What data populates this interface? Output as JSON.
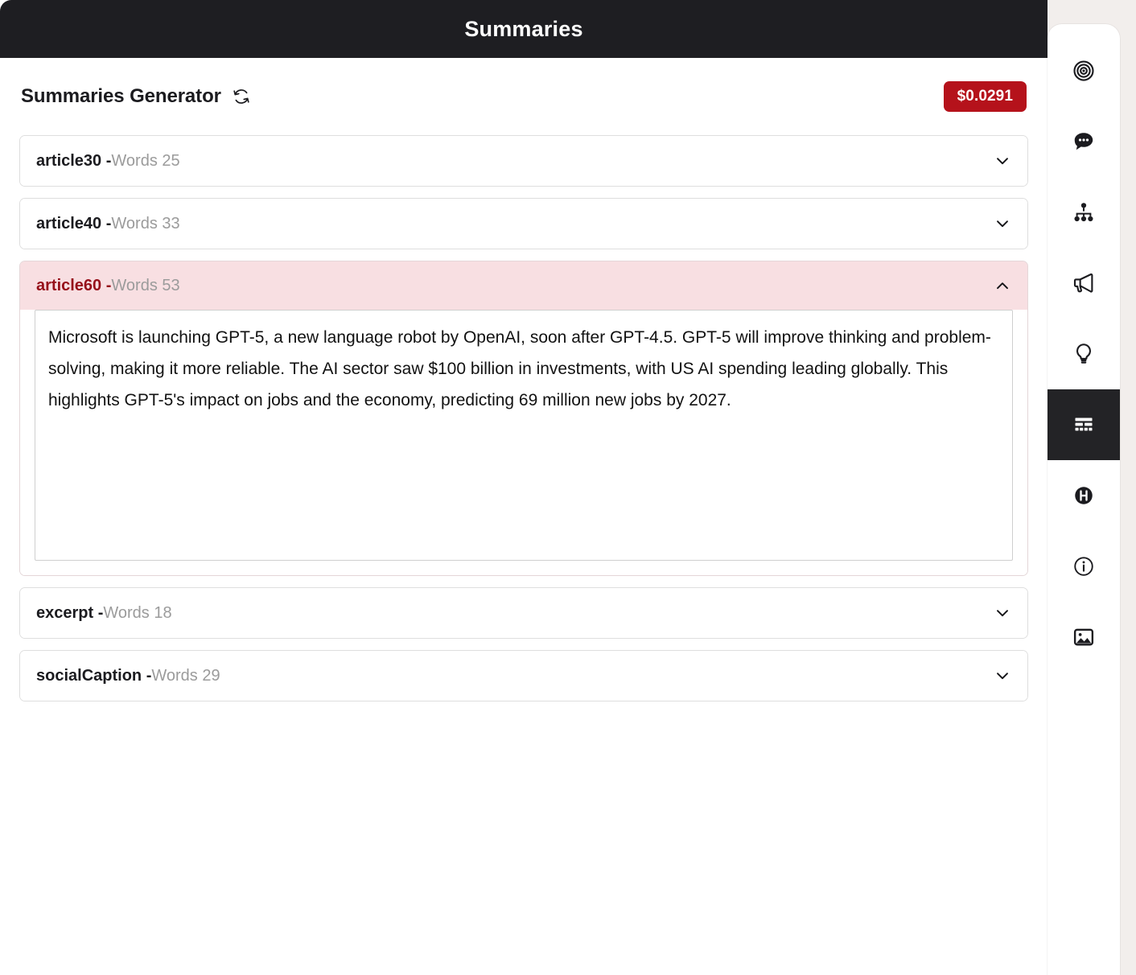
{
  "window": {
    "title": "Summaries"
  },
  "generator": {
    "heading": "Summaries Generator",
    "refresh_icon": "refresh-icon",
    "cost_badge": "$0.0291",
    "accent_color": "#b5121b",
    "open_header_bg": "#f8dfe2",
    "open_key_color": "#96101a"
  },
  "accordion": {
    "words_prefix": "Words",
    "separator": " -",
    "items": [
      {
        "key": "article30",
        "words_label": "Words 25",
        "word_count": 25,
        "expanded": false,
        "chevron": "chevron-down-icon",
        "body": ""
      },
      {
        "key": "article40",
        "words_label": "Words 33",
        "word_count": 33,
        "expanded": false,
        "chevron": "chevron-down-icon",
        "body": ""
      },
      {
        "key": "article60",
        "words_label": "Words 53",
        "word_count": 53,
        "expanded": true,
        "chevron": "chevron-up-icon",
        "body": "Microsoft is launching GPT-5, a new language robot by OpenAI, soon after GPT-4.5. GPT-5 will improve thinking and problem-solving, making it more reliable. The AI sector saw $100 billion in investments, with US AI spending leading globally. This highlights GPT-5's impact on jobs and the economy, predicting 69 million new jobs by 2027."
      },
      {
        "key": "excerpt",
        "words_label": "Words 18",
        "word_count": 18,
        "expanded": false,
        "chevron": "chevron-down-icon",
        "body": ""
      },
      {
        "key": "socialCaption",
        "words_label": "Words 29",
        "word_count": 29,
        "expanded": false,
        "chevron": "chevron-down-icon",
        "body": ""
      }
    ]
  },
  "rail": {
    "items": [
      {
        "icon": "target-icon",
        "active": false
      },
      {
        "icon": "chat-bubble-icon",
        "active": false
      },
      {
        "icon": "hierarchy-icon",
        "active": false
      },
      {
        "icon": "megaphone-icon",
        "active": false
      },
      {
        "icon": "lightbulb-icon",
        "active": false
      },
      {
        "icon": "summaries-layout-icon",
        "active": true
      },
      {
        "icon": "h-circle-icon",
        "active": false
      },
      {
        "icon": "info-icon",
        "active": false
      },
      {
        "icon": "image-icon",
        "active": false
      }
    ]
  }
}
